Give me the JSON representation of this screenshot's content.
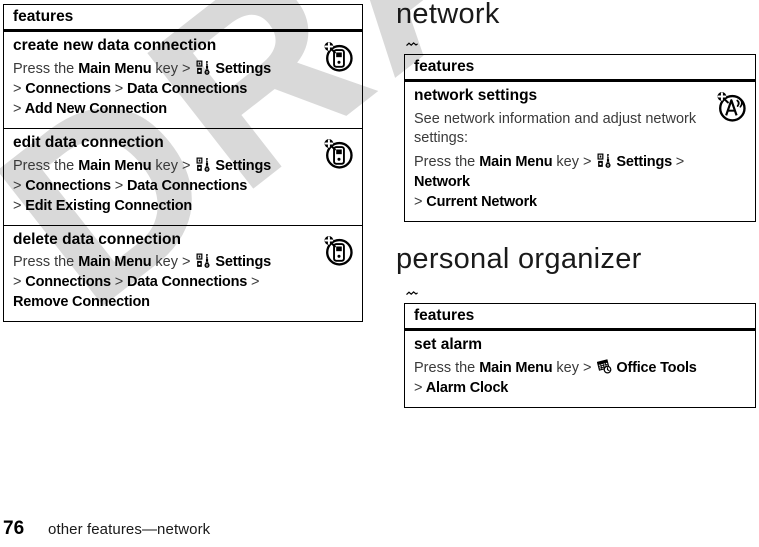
{
  "watermark": {
    "text": "DRAFT"
  },
  "footer": {
    "page_number": "76",
    "title": "other features—network"
  },
  "left_column": {
    "table": {
      "header": "features",
      "rows": [
        {
          "title": "create new data connection",
          "icon": "new-data-connection-icon",
          "lines": [
            [
              {
                "t": "Press the ",
                "s": "plain"
              },
              {
                "t": "Main Menu",
                "s": "bold"
              },
              {
                "t": " key ",
                "s": "plain"
              },
              {
                "t": ">",
                "s": "gt"
              },
              {
                "t": " ",
                "s": "plain"
              },
              {
                "t": "settings-icon",
                "s": "icon"
              },
              {
                "t": " Settings",
                "s": "bold"
              }
            ],
            [
              {
                "t": ">",
                "s": "gt"
              },
              {
                "t": " Connections ",
                "s": "bold"
              },
              {
                "t": ">",
                "s": "gt"
              },
              {
                "t": " Data Connections",
                "s": "bold"
              }
            ],
            [
              {
                "t": ">",
                "s": "gt"
              },
              {
                "t": " Add New Connection",
                "s": "bold"
              }
            ]
          ]
        },
        {
          "title": "edit data connection",
          "icon": "edit-data-connection-icon",
          "lines": [
            [
              {
                "t": "Press the ",
                "s": "plain"
              },
              {
                "t": "Main Menu",
                "s": "bold"
              },
              {
                "t": " key ",
                "s": "plain"
              },
              {
                "t": ">",
                "s": "gt"
              },
              {
                "t": " ",
                "s": "plain"
              },
              {
                "t": "settings-icon",
                "s": "icon"
              },
              {
                "t": " Settings",
                "s": "bold"
              }
            ],
            [
              {
                "t": ">",
                "s": "gt"
              },
              {
                "t": " Connections ",
                "s": "bold"
              },
              {
                "t": ">",
                "s": "gt"
              },
              {
                "t": " Data Connections",
                "s": "bold"
              }
            ],
            [
              {
                "t": ">",
                "s": "gt"
              },
              {
                "t": " Edit Existing Connection",
                "s": "bold"
              }
            ]
          ]
        },
        {
          "title": "delete data connection",
          "icon": "delete-data-connection-icon",
          "lines": [
            [
              {
                "t": "Press the ",
                "s": "plain"
              },
              {
                "t": "Main Menu",
                "s": "bold"
              },
              {
                "t": " key ",
                "s": "plain"
              },
              {
                "t": ">",
                "s": "gt"
              },
              {
                "t": " ",
                "s": "plain"
              },
              {
                "t": "settings-icon",
                "s": "icon"
              },
              {
                "t": " Settings",
                "s": "bold"
              }
            ],
            [
              {
                "t": ">",
                "s": "gt"
              },
              {
                "t": " Connections ",
                "s": "bold"
              },
              {
                "t": ">",
                "s": "gt"
              },
              {
                "t": " Data Connections ",
                "s": "bold"
              },
              {
                "t": ">",
                "s": "gt"
              },
              {
                "t": " Remove Connection",
                "s": "bold"
              }
            ]
          ]
        }
      ]
    }
  },
  "right_column": {
    "network": {
      "heading": "network",
      "table": {
        "header": "features",
        "rows": [
          {
            "title": "network settings",
            "icon": "network-settings-icon",
            "description": "See network information and adjust network settings:",
            "lines": [
              [
                {
                  "t": "Press the ",
                  "s": "plain"
                },
                {
                  "t": "Main Menu",
                  "s": "bold"
                },
                {
                  "t": " key ",
                  "s": "plain"
                },
                {
                  "t": ">",
                  "s": "gt"
                },
                {
                  "t": " ",
                  "s": "plain"
                },
                {
                  "t": "settings-icon",
                  "s": "icon"
                },
                {
                  "t": " Settings ",
                  "s": "bold"
                },
                {
                  "t": ">",
                  "s": "gt"
                },
                {
                  "t": " Network",
                  "s": "bold"
                }
              ],
              [
                {
                  "t": ">",
                  "s": "gt"
                },
                {
                  "t": " Current Network",
                  "s": "bold"
                }
              ]
            ]
          }
        ]
      }
    },
    "organizer": {
      "heading": "personal organizer",
      "table": {
        "header": "features",
        "rows": [
          {
            "title": "set alarm",
            "icon": null,
            "lines": [
              [
                {
                  "t": "Press the ",
                  "s": "plain"
                },
                {
                  "t": "Main Menu",
                  "s": "bold"
                },
                {
                  "t": " key ",
                  "s": "plain"
                },
                {
                  "t": ">",
                  "s": "gt"
                },
                {
                  "t": " ",
                  "s": "plain"
                },
                {
                  "t": "office-tools-icon",
                  "s": "icon"
                },
                {
                  "t": " Office Tools",
                  "s": "bold"
                }
              ],
              [
                {
                  "t": ">",
                  "s": "gt"
                },
                {
                  "t": " Alarm Clock",
                  "s": "bold"
                }
              ]
            ]
          }
        ]
      }
    }
  }
}
